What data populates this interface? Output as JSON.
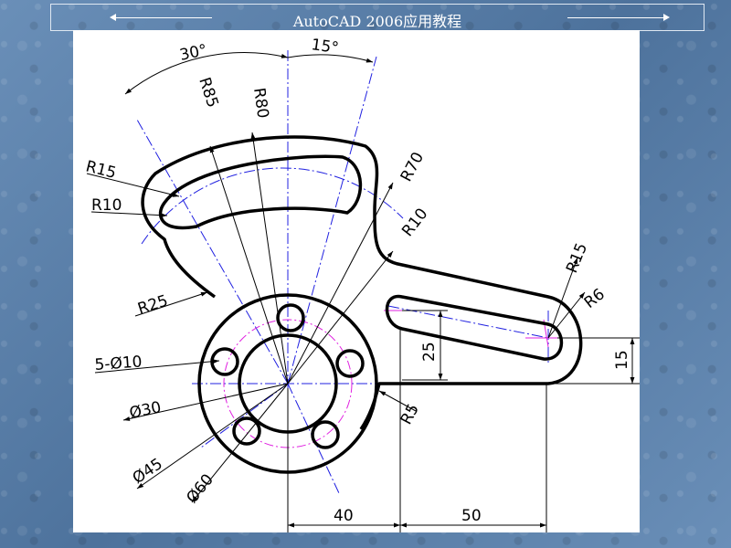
{
  "header": {
    "title": "AutoCAD 2006应用教程"
  },
  "drawing": {
    "dimensions": {
      "angle_30": "30°",
      "angle_15": "15°",
      "r85": "R85",
      "r80": "R80",
      "r70": "R70",
      "r10_right": "R10",
      "r15_left": "R15",
      "r10_left": "R10",
      "r25": "R25",
      "r15_slot": "R15",
      "r6": "R6",
      "d25": "25",
      "d15": "15",
      "holes": "5-Ø10",
      "dia30": "Ø30",
      "dia45": "Ø45",
      "dia60": "Ø60",
      "r5": "R5",
      "d40": "40",
      "d50": "50"
    }
  }
}
